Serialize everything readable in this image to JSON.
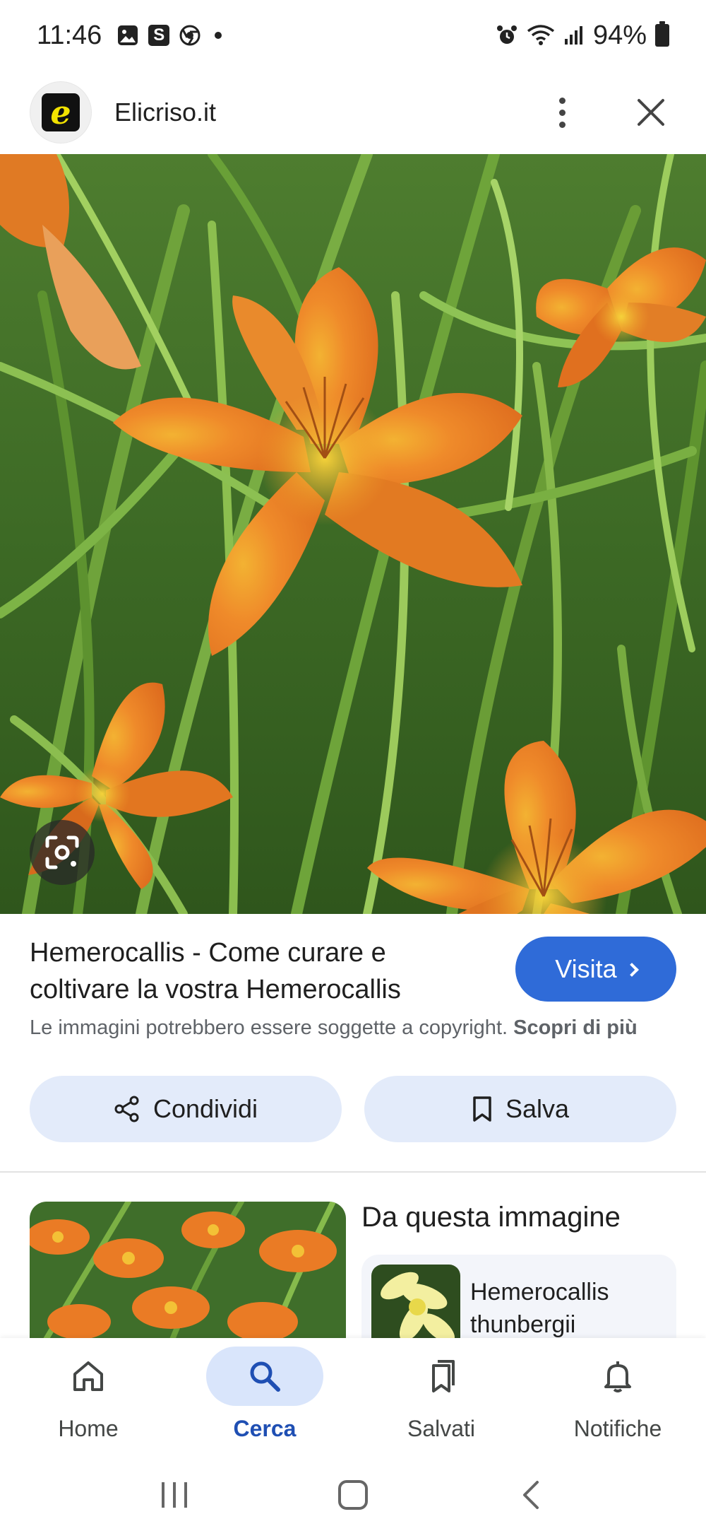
{
  "status_bar": {
    "time": "11:46",
    "s_badge": "S",
    "battery": "94%"
  },
  "header": {
    "logo_letter": "e",
    "site_name": "Elicriso.it"
  },
  "result": {
    "title": "Hemerocallis - Come curare e coltivare la vostra Hemerocallis",
    "visit_label": "Visita",
    "copyright_text": "Le immagini potrebbero essere soggette a copyright.",
    "learn_more": "Scopri di più"
  },
  "actions": {
    "share_label": "Condividi",
    "save_label": "Salva"
  },
  "related": {
    "heading": "Da questa immagine",
    "item_label": "Hemerocallis thunbergii"
  },
  "bottom_nav": {
    "items": [
      {
        "label": "Home",
        "icon": "home-icon"
      },
      {
        "label": "Cerca",
        "icon": "search-icon",
        "active": true
      },
      {
        "label": "Salvati",
        "icon": "bookmarks-icon"
      },
      {
        "label": "Notifiche",
        "icon": "bell-icon"
      }
    ]
  },
  "colors": {
    "accent": "#2f6bd8",
    "pill": "#e3ebfa",
    "active_nav": "#1f4fb3"
  }
}
